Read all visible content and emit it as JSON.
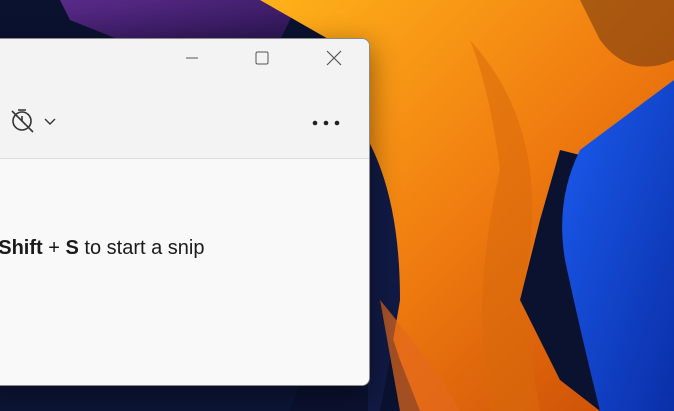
{
  "window": {
    "caption": {
      "minimize_icon": "minimize-icon",
      "maximize_icon": "maximize-icon",
      "close_icon": "close-icon"
    },
    "toolbar": {
      "delay_icon": "timer-off-icon",
      "delay_chevron": "chevron-down-icon",
      "more_icon": "more-horizontal-icon"
    },
    "hint": {
      "plus_1": "+",
      "shift": "Shift",
      "plus_2": "+",
      "s": "S",
      "rest": "to start a snip"
    }
  },
  "colors": {
    "window_bg": "#f9f9f9",
    "toolbar_bg": "#f3f3f3",
    "text": "#1a1a1a",
    "wallpaper_orange": "#f08a12",
    "wallpaper_blue": "#1447d6",
    "wallpaper_dark": "#0b1230"
  }
}
